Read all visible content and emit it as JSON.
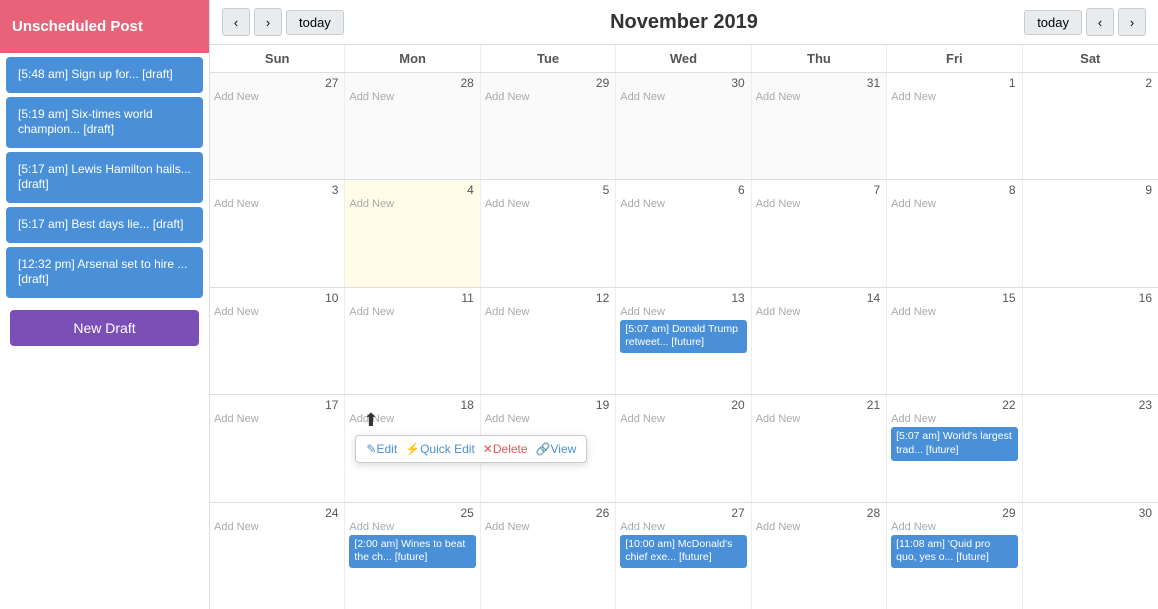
{
  "sidebar": {
    "unscheduled_label": "Unscheduled Post",
    "posts": [
      {
        "label": "[5:48 am] Sign up for... [draft]"
      },
      {
        "label": "[5:19 am] Six-times world champion... [draft]"
      },
      {
        "label": "[5:17 am] Lewis Hamilton hails... [draft]"
      },
      {
        "label": "[5:17 am] Best days lie... [draft]"
      },
      {
        "label": "[12:32 pm] Arsenal set to hire ... [draft]"
      }
    ],
    "new_draft_label": "New Draft"
  },
  "calendar": {
    "title": "November 2019",
    "today_label_left": "today",
    "today_label_right": "today",
    "prev_label": "‹",
    "next_label": "›",
    "day_headers": [
      "Sun",
      "Mon",
      "Tue",
      "Wed",
      "Thu",
      "Fri",
      "Sat"
    ],
    "weeks": [
      {
        "days": [
          {
            "num": "27",
            "other": true,
            "addnew": true
          },
          {
            "num": "28",
            "other": true,
            "addnew": true
          },
          {
            "num": "29",
            "other": true,
            "addnew": true
          },
          {
            "num": "30",
            "other": true,
            "addnew": true
          },
          {
            "num": "31",
            "other": true,
            "addnew": true
          },
          {
            "num": "1",
            "addnew": true
          },
          {
            "num": "2",
            "addnew": false
          }
        ]
      },
      {
        "days": [
          {
            "num": "3",
            "addnew": true
          },
          {
            "num": "4",
            "today": true,
            "addnew": true
          },
          {
            "num": "5",
            "addnew": true
          },
          {
            "num": "6",
            "addnew": true
          },
          {
            "num": "7",
            "addnew": true
          },
          {
            "num": "8",
            "addnew": true
          },
          {
            "num": "9",
            "addnew": false
          }
        ]
      },
      {
        "days": [
          {
            "num": "10",
            "addnew": true
          },
          {
            "num": "11",
            "addnew": true
          },
          {
            "num": "12",
            "addnew": true
          },
          {
            "num": "13",
            "addnew": true,
            "event": "[5:07 am] Donald Trump retweet... [future]"
          },
          {
            "num": "14",
            "addnew": true
          },
          {
            "num": "15",
            "addnew": true
          },
          {
            "num": "16",
            "addnew": false
          }
        ]
      },
      {
        "days": [
          {
            "num": "17",
            "addnew": true
          },
          {
            "num": "18",
            "addnew": true,
            "popup": true
          },
          {
            "num": "19",
            "addnew": true
          },
          {
            "num": "20",
            "addnew": true
          },
          {
            "num": "21",
            "addnew": true
          },
          {
            "num": "22",
            "addnew": true,
            "event": "[5:07 am] World's largest trad... [future]"
          },
          {
            "num": "23",
            "addnew": false
          }
        ]
      },
      {
        "days": [
          {
            "num": "24",
            "addnew": true
          },
          {
            "num": "25",
            "addnew": true,
            "event": "[2:00 am] Wines to beat the ch... [future]"
          },
          {
            "num": "26",
            "addnew": true
          },
          {
            "num": "27",
            "addnew": true,
            "event": "[10:00 am] McDonald's chief exe... [future]"
          },
          {
            "num": "28",
            "addnew": true
          },
          {
            "num": "29",
            "addnew": true,
            "event": "[11:08 am] 'Quid pro quo, yes o... [future]"
          },
          {
            "num": "30",
            "addnew": false
          }
        ]
      }
    ],
    "popup": {
      "edit": "Edit",
      "quick_edit": "Quick Edit",
      "delete": "Delete",
      "view": "View"
    }
  }
}
